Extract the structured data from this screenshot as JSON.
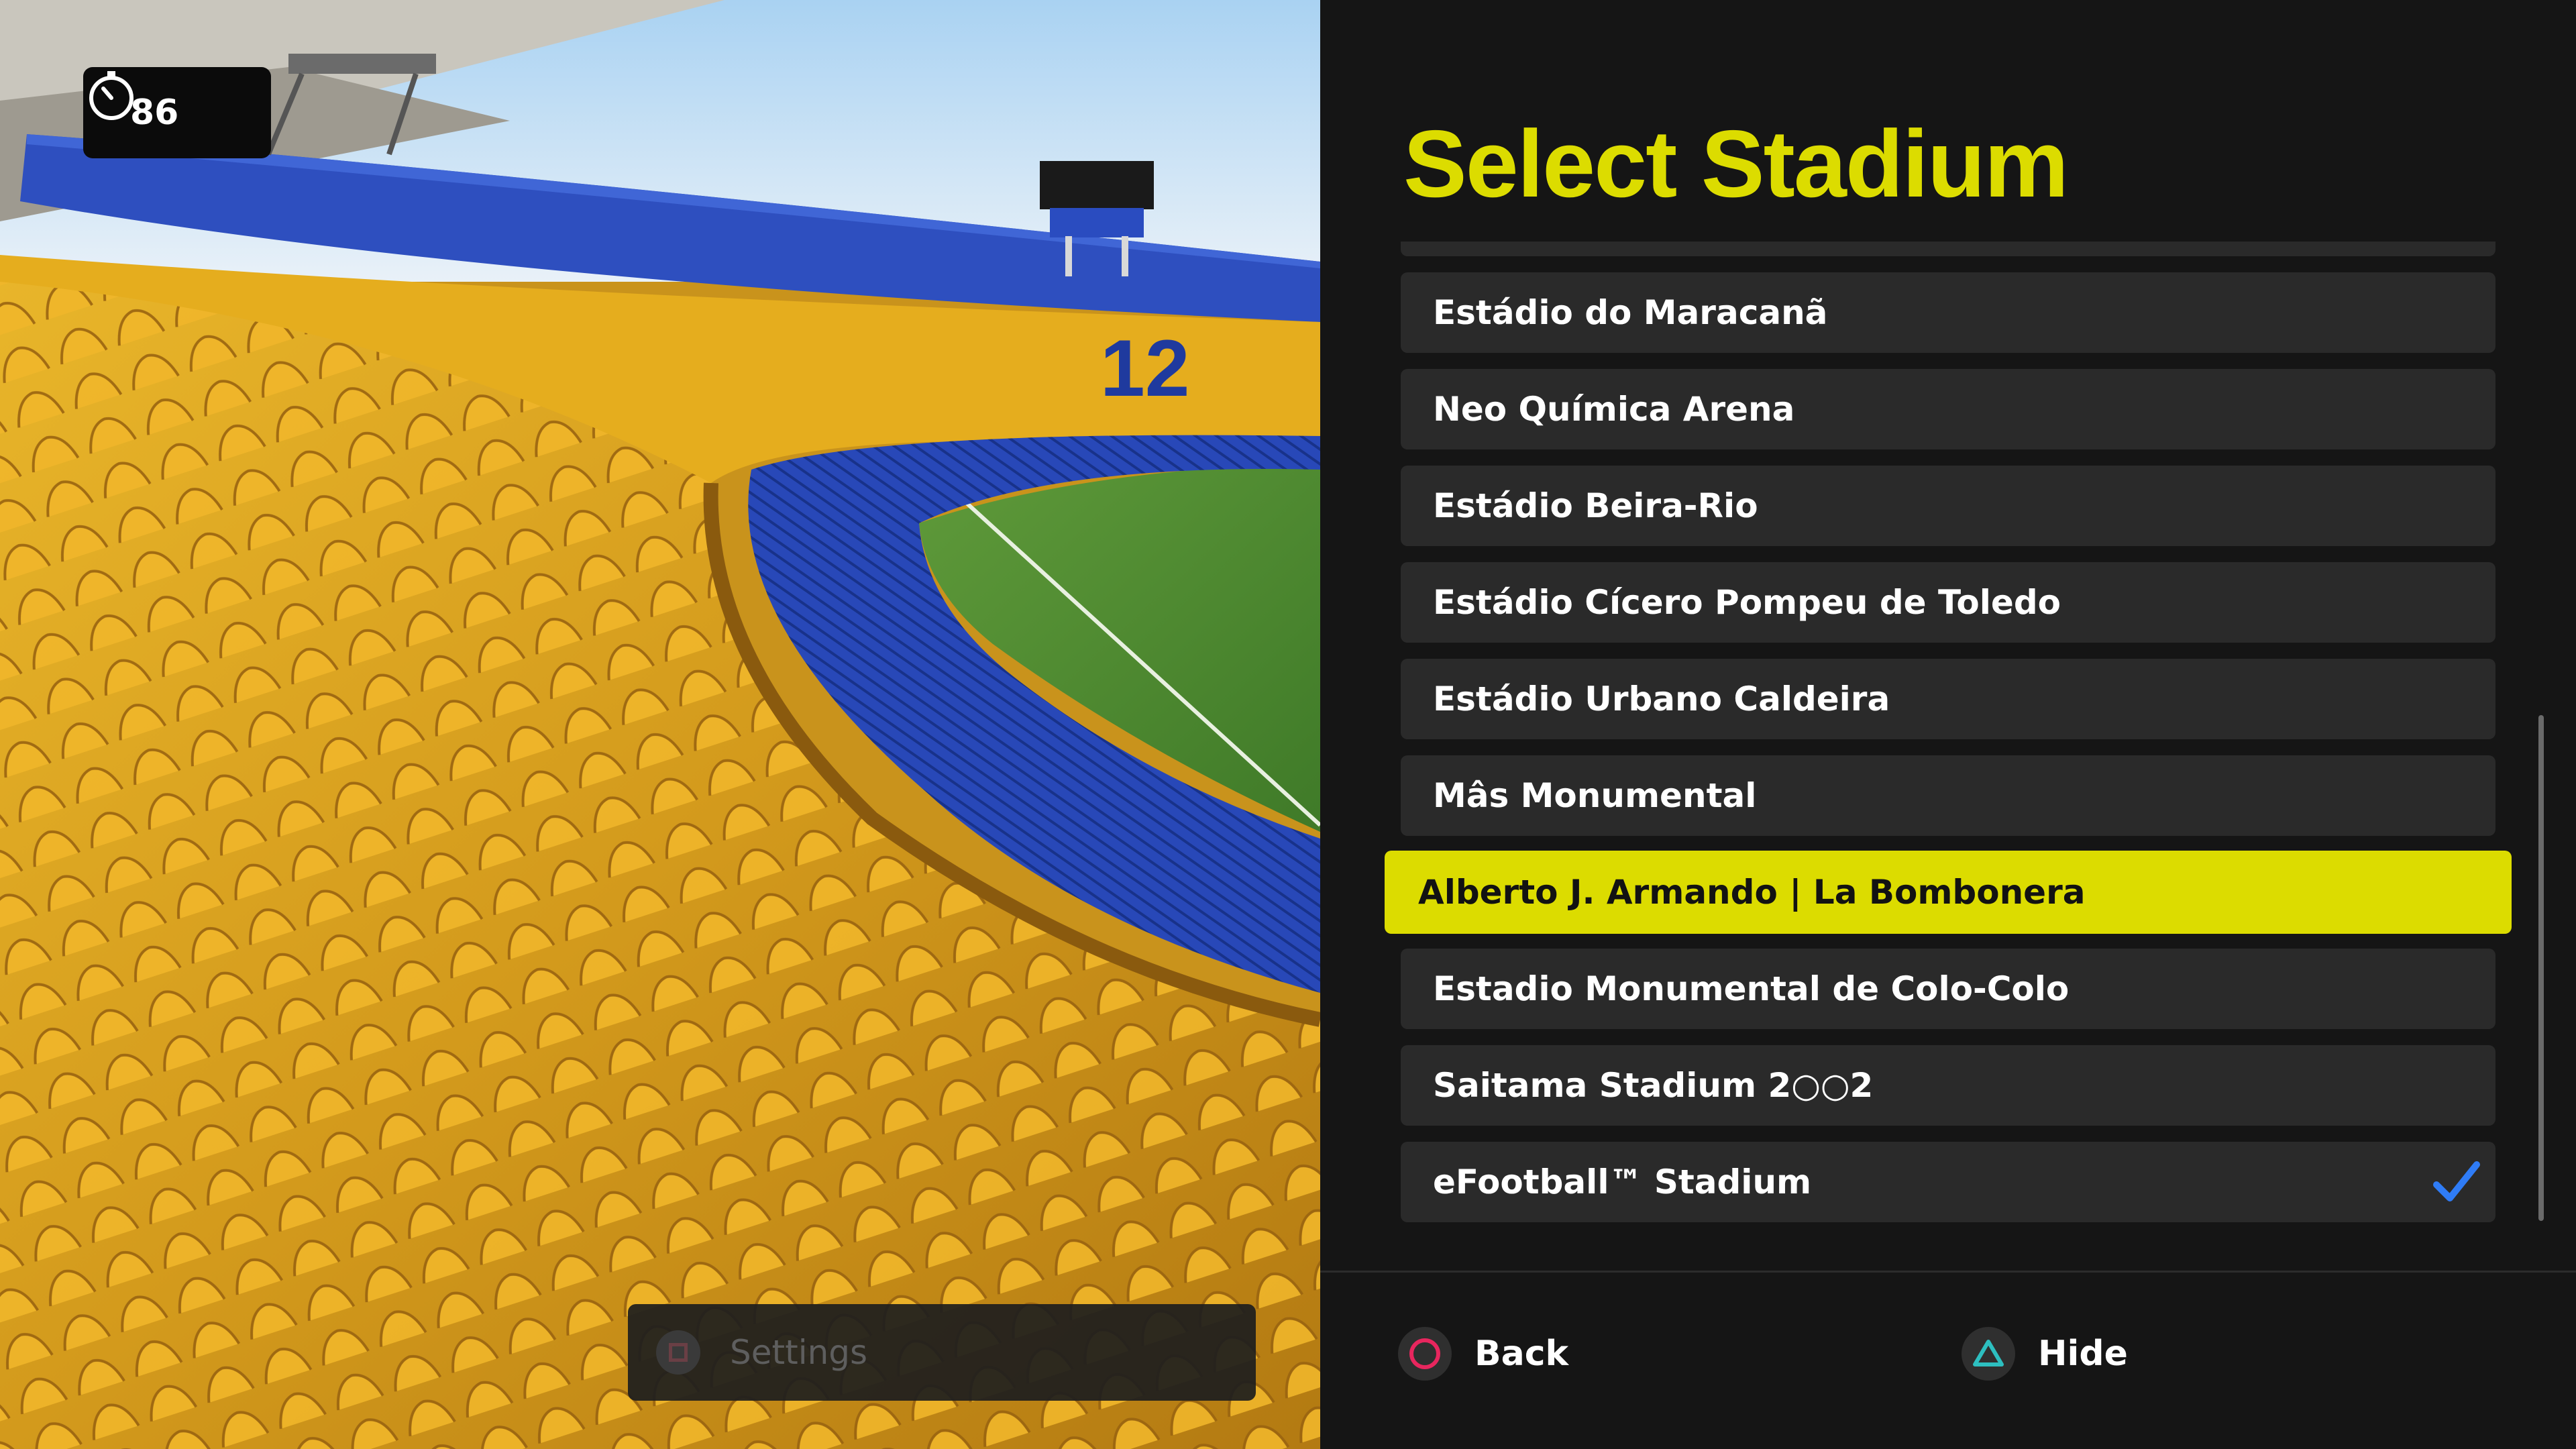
{
  "timer": {
    "icon": "stopwatch-icon",
    "value": "86"
  },
  "preview": {
    "settings_label": "Settings",
    "settings_icon": "square-button-icon"
  },
  "panel": {
    "title": "Select Stadium",
    "stadiums": [
      {
        "name": "",
        "partial": true
      },
      {
        "name": "Estádio do Maracanã"
      },
      {
        "name": "Neo Química Arena"
      },
      {
        "name": "Estádio Beira-Rio"
      },
      {
        "name": "Estádio Cícero Pompeu de Toledo"
      },
      {
        "name": "Estádio Urbano Caldeira"
      },
      {
        "name": "Mâs Monumental"
      },
      {
        "name": "Alberto J. Armando | La Bombonera",
        "selected": true
      },
      {
        "name": "Estadio Monumental de Colo-Colo"
      },
      {
        "name": "Saitama Stadium 2○○2"
      },
      {
        "name": "eFootball™ Stadium",
        "checked": true
      }
    ],
    "selected_color": "#dcdc00",
    "check_color": "#2f7cf6"
  },
  "footer": {
    "back": {
      "icon": "circle-button-icon",
      "label": "Back"
    },
    "hide": {
      "icon": "triangle-button-icon",
      "label": "Hide"
    }
  },
  "colors": {
    "accent": "#dcdc00",
    "background": "#151515",
    "row": "#2a2a2a"
  }
}
